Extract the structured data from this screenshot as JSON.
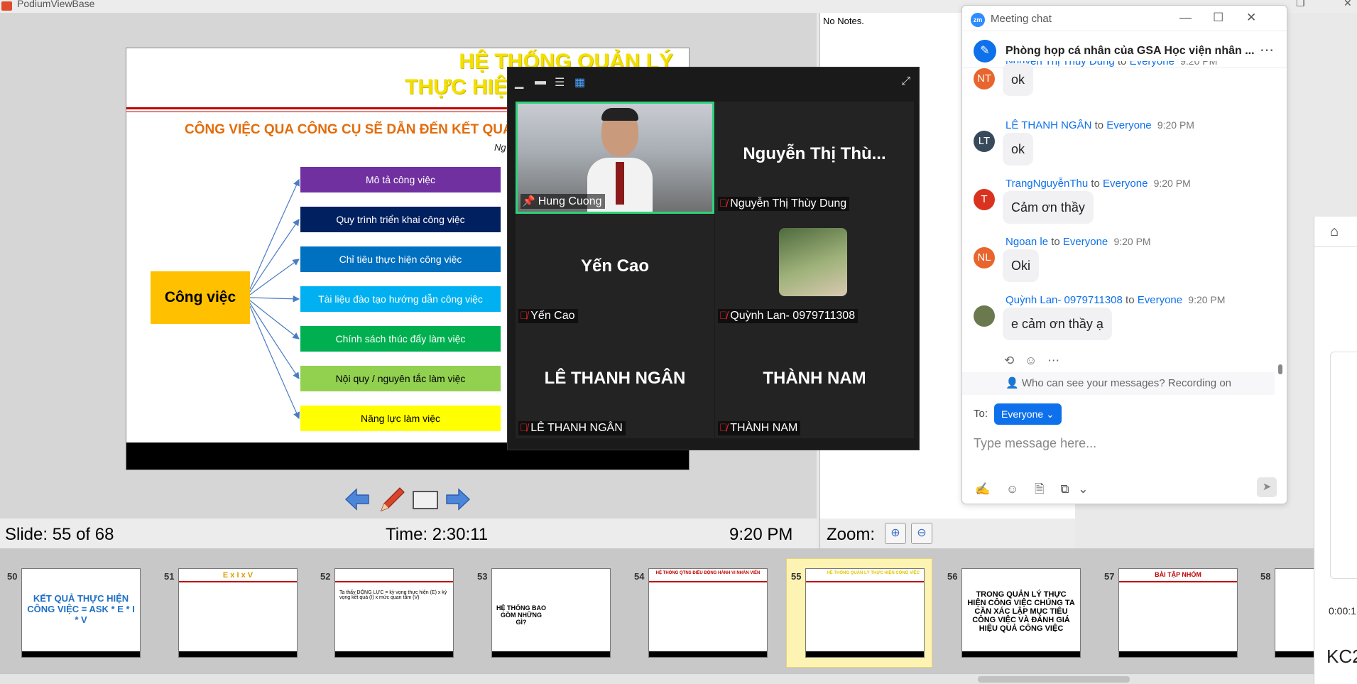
{
  "window": {
    "title": "PodiumViewBase"
  },
  "slide": {
    "title_line1": "HỆ THỐNG QUẢN LÝ",
    "title_line2": "THỰC HIỆN CÔNG VIỆC",
    "subtitle": "CÔNG VIỆC QUA CÔNG CỤ SẼ DẪN ĐẾN KẾT QUẢ",
    "author": "Ng",
    "center": "Công việc",
    "items": [
      {
        "label": "Mô tả công việc",
        "color": "#7030a0",
        "text_color": "#ffffff"
      },
      {
        "label": "Quy trình triển khai công việc",
        "color": "#002060",
        "text_color": "#ffffff"
      },
      {
        "label": "Chỉ tiêu thực hiện công việc",
        "color": "#0070c0",
        "text_color": "#ffffff"
      },
      {
        "label": "Tài liệu đào tạo hướng dẫn công việc",
        "color": "#00b0f0",
        "text_color": "#ffffff"
      },
      {
        "label": "Chính sách thúc đẩy làm việc",
        "color": "#00b050",
        "text_color": "#ffffff"
      },
      {
        "label": "Nội quy / nguyên tắc làm việc",
        "color": "#92d050",
        "text_color": "#000000"
      },
      {
        "label": "Năng lực làm việc",
        "color": "#ffff00",
        "text_color": "#000000"
      }
    ]
  },
  "status": {
    "slide": "Slide: 55 of 68",
    "time": "Time: 2:30:11",
    "clock": "9:20 PM"
  },
  "notes": {
    "text": "No Notes."
  },
  "zoom": {
    "label": "Zoom:"
  },
  "thumbnails": [
    {
      "num": "50",
      "text": "KẾT QUẢ THỰC HIỆN CÔNG VIỆC = ASK * E * I * V"
    },
    {
      "num": "51",
      "text": "E x I x V"
    },
    {
      "num": "52",
      "text": "Ta thấy ĐỘNG LỰC = kỳ vọng thực hiện (E) x kỳ vọng kết quả (I) x mức quan tâm (V)"
    },
    {
      "num": "53",
      "text": "HỆ THỐNG BAO GỒM NHỮNG GÌ?"
    },
    {
      "num": "54",
      "text": "HỆ THỐNG QTNS ĐIỀU ĐỘNG HÀNH VI NHÂN VIÊN"
    },
    {
      "num": "55",
      "text": "HỆ THỐNG QUẢN LÝ THỰC HIỆN CÔNG VIỆC"
    },
    {
      "num": "56",
      "text": "TRONG QUẢN LÝ THỰC HIỆN CÔNG VIỆC CHÚNG TA CẦN XÁC LẬP MỤC TIÊU CÔNG VIỆC VÀ ĐÁNH GIÁ HIỆU QUẢ CÔNG VIỆC"
    },
    {
      "num": "57",
      "text": "BÀI TẬP NHÓM"
    },
    {
      "num": "58",
      "text": ""
    }
  ],
  "gallery": {
    "tiles": [
      {
        "name": "",
        "label": "Hung Cuong",
        "muted": false,
        "pinned": true
      },
      {
        "name": "Nguyễn Thị Thù...",
        "label": "Nguyễn Thị Thùy Dung",
        "muted": true
      },
      {
        "name": "Yến Cao",
        "label": "Yến Cao",
        "muted": true
      },
      {
        "name": "",
        "label": "Quỳnh Lan- 0979711308",
        "muted": true
      },
      {
        "name": "LÊ THANH NGÂN",
        "label": "LÊ THANH NGÂN",
        "muted": true
      },
      {
        "name": "THÀNH NAM",
        "label": "THÀNH NAM",
        "muted": true
      }
    ]
  },
  "chat": {
    "window_title": "Meeting chat",
    "header": "Phòng họp cá nhân của GSA Học viện nhân ...",
    "messages": [
      {
        "initials": "NT",
        "color": "#e8652d",
        "sender": "Nguyễn Thị Thùy Dung",
        "to": "to",
        "recipient": "Everyone",
        "time": "9:20 PM",
        "text": "ok"
      },
      {
        "initials": "LT",
        "color": "#37495b",
        "sender": "LÊ THANH NGÂN",
        "to": "to",
        "recipient": "Everyone",
        "time": "9:20 PM",
        "text": "ok"
      },
      {
        "initials": "T",
        "color": "#d9331f",
        "sender": "TrangNguyễnThu",
        "to": "to",
        "recipient": "Everyone",
        "time": "9:20 PM",
        "text": "Cảm ơn thầy"
      },
      {
        "initials": "NL",
        "color": "#e8652d",
        "sender": "Ngoan le",
        "to": "to",
        "recipient": "Everyone",
        "time": "9:20 PM",
        "text": "Oki"
      },
      {
        "initials": "",
        "color": "#6b7a4e",
        "sender": "Quỳnh Lan- 0979711308",
        "to": "to",
        "recipient": "Everyone",
        "time": "9:20 PM",
        "text": "e cảm ơn thầy ạ"
      }
    ],
    "visibility": "Who can see your messages? Recording on",
    "to_label": "To:",
    "to_value": "Everyone",
    "placeholder": "Type message here..."
  },
  "edge": {
    "time": "0:00:1",
    "label": "KC2"
  }
}
